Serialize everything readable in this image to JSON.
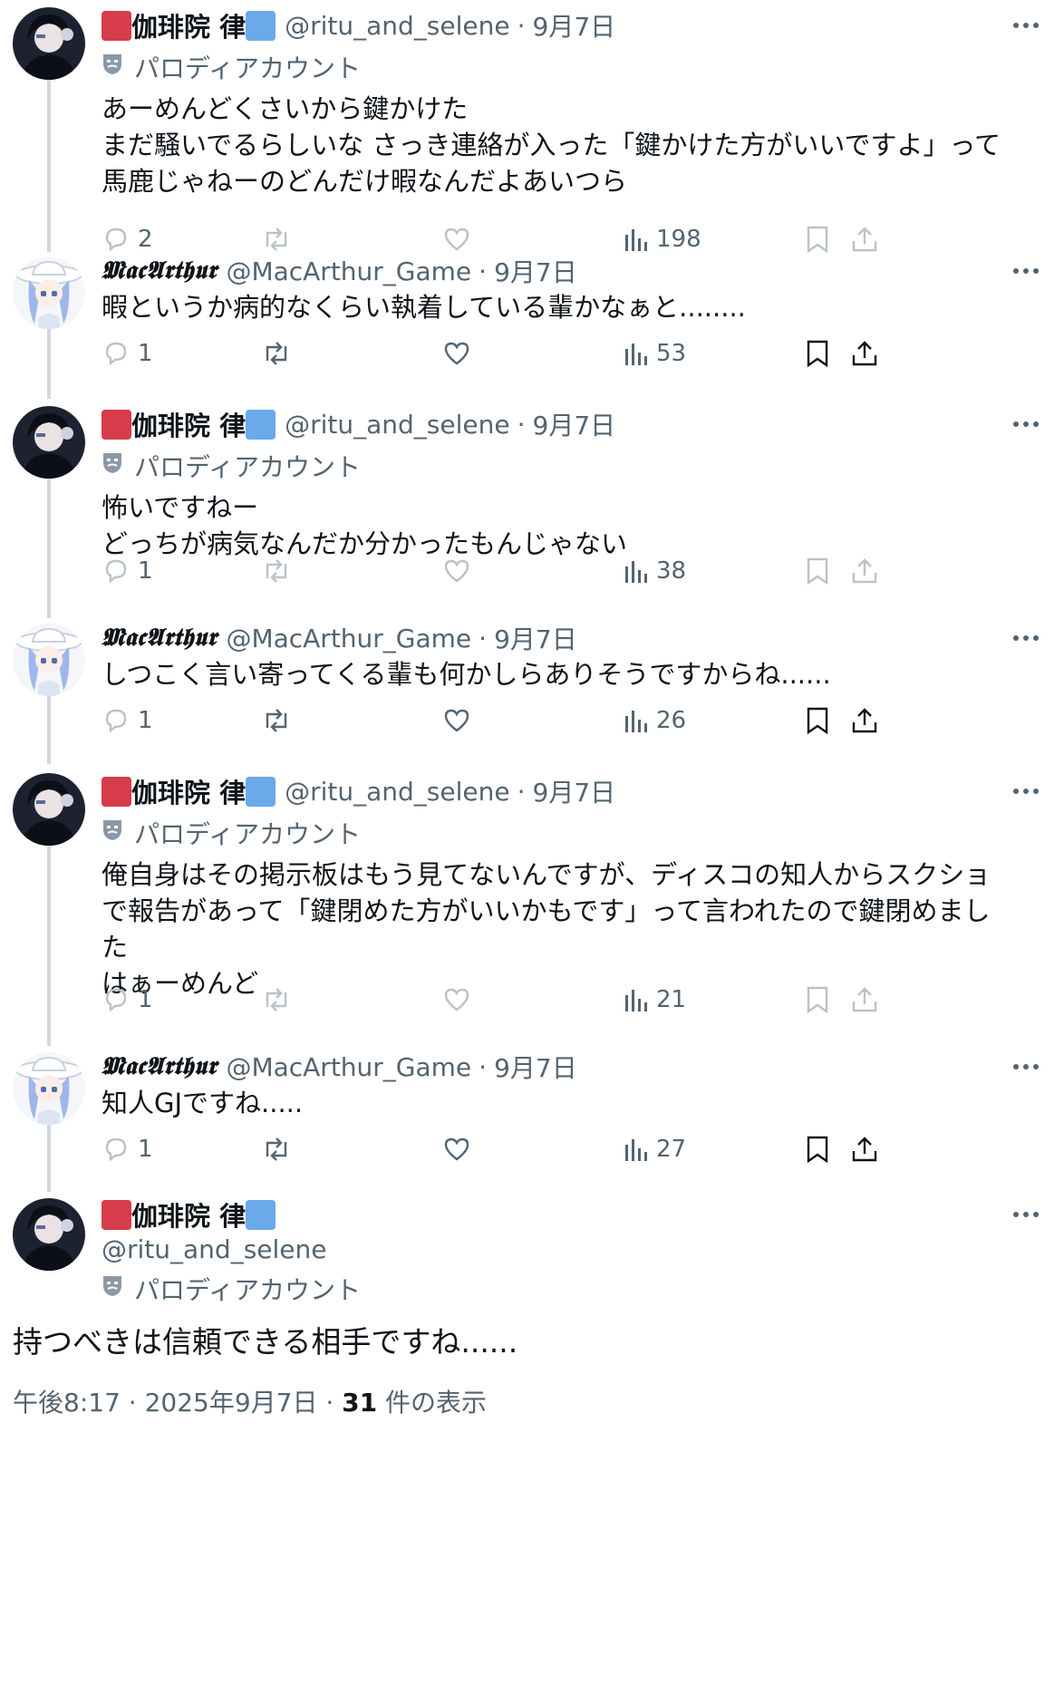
{
  "colors": {
    "red_tag": "#d63c4a",
    "blue_tag": "#6aa9ea",
    "muted": "#536471",
    "line": "#cfd9de"
  },
  "users": {
    "ritsu": {
      "name": "伽琲院 律",
      "handle": "@ritu_and_selene",
      "badge": "パロディアカウント"
    },
    "mac": {
      "name": "𝕸𝖆𝖈𝕬𝖗𝖙𝖍𝖚𝖗",
      "handle": "@MacArthur_Game"
    }
  },
  "sep": "·",
  "tweets": [
    {
      "date": "9月7日",
      "text": "あーめんどくさいから鍵かけた\nまだ騒いでるらしいな さっき連絡が入った「鍵かけた方がいいですよ」って\n馬鹿じゃねーのどんだけ暇なんだよあいつら",
      "replies": "2",
      "views": "198"
    },
    {
      "date": "9月7日",
      "text": "暇というか病的なくらい執着している輩かなぁと........",
      "replies": "1",
      "views": "53"
    },
    {
      "date": "9月7日",
      "text": "怖いですねー\nどっちが病気なんだか分かったもんじゃない",
      "replies": "1",
      "views": "38"
    },
    {
      "date": "9月7日",
      "text": "しつこく言い寄ってくる輩も何かしらありそうですからね......",
      "replies": "1",
      "views": "26"
    },
    {
      "date": "9月7日",
      "text": "俺自身はその掲示板はもう見てないんですが、ディスコの知人からスクショ\nで報告があって「鍵閉めた方がいいかもです」って言われたので鍵閉めまし\nた\nはぁーめんど",
      "replies": "1",
      "views": "21"
    },
    {
      "date": "9月7日",
      "text": "知人GJですね.....",
      "replies": "1",
      "views": "27"
    }
  ],
  "main": {
    "text": "持つべきは信頼できる相手ですね......",
    "time": "午後8:17 · 2025年9月7日 · ",
    "views": "31",
    "views_label": " 件の表示"
  },
  "icons": [
    "reply-icon",
    "retweet-icon",
    "like-icon",
    "views-icon",
    "bookmark-icon",
    "share-icon",
    "more-icon",
    "mask-icon"
  ]
}
